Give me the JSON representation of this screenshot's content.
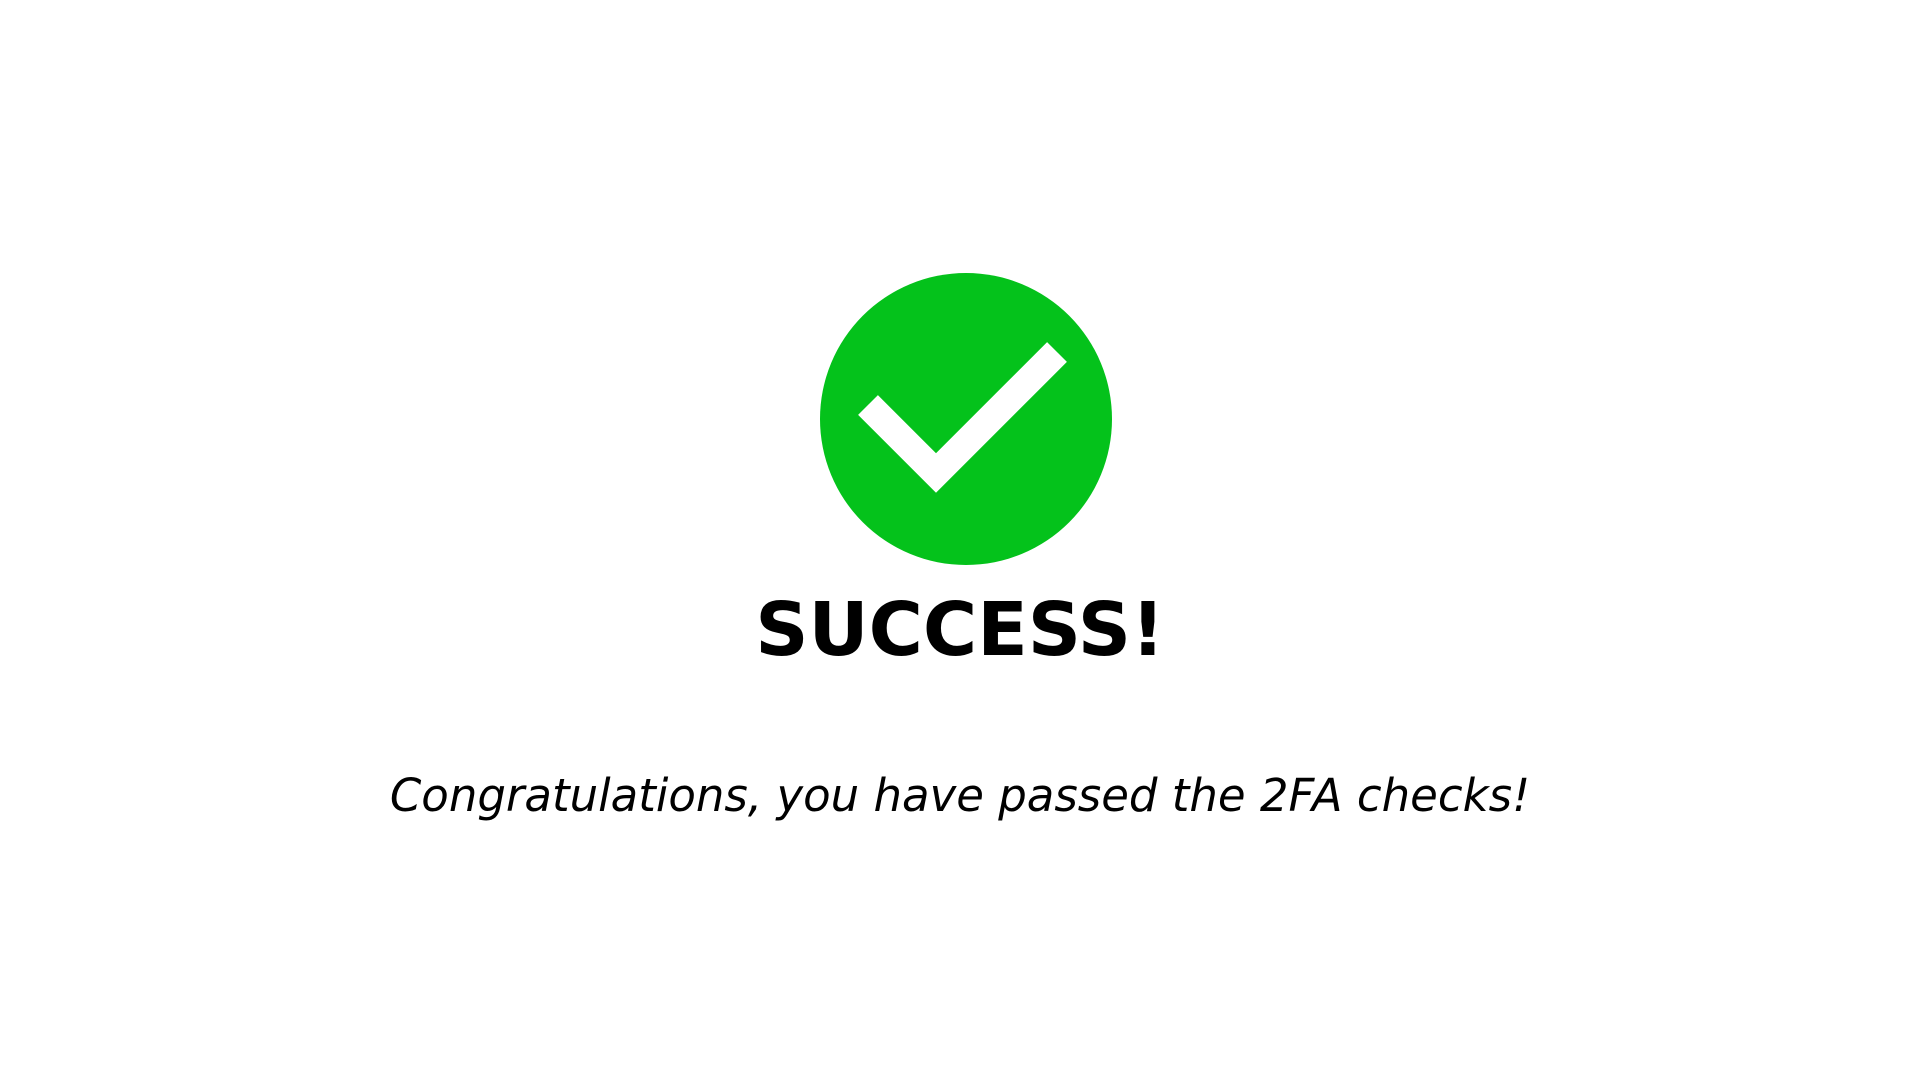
{
  "success_screen": {
    "icon": "check-circle-icon",
    "title": "SUCCESS!",
    "message": "Congratulations, you have passed the 2FA checks!"
  },
  "colors": {
    "background": "#ffffff",
    "success_green": "#04c21b",
    "check_mark": "#ffffff",
    "text": "#000000"
  }
}
